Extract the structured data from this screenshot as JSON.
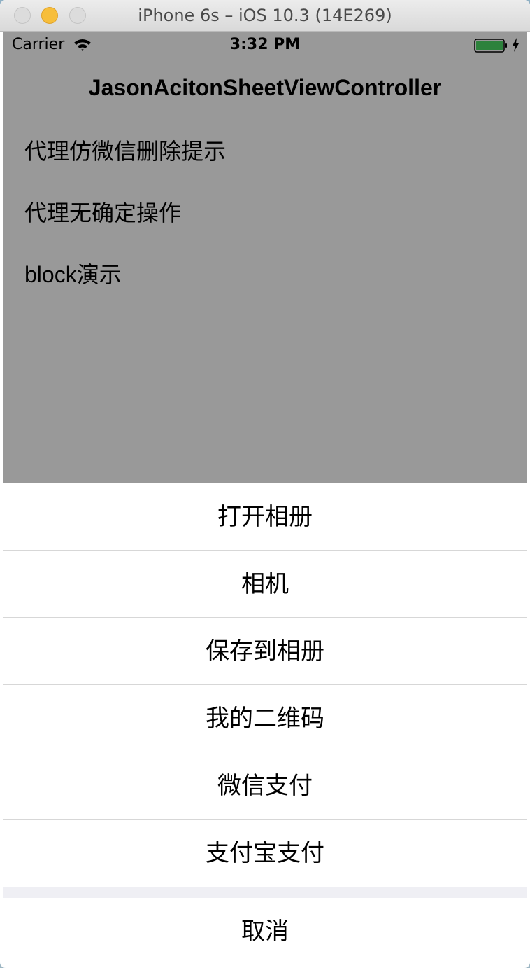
{
  "window": {
    "title": "iPhone 6s – iOS 10.3 (14E269)"
  },
  "status_bar": {
    "carrier": "Carrier",
    "time": "3:32 PM",
    "wifi_icon": "wifi-icon",
    "battery_icon": "battery-icon",
    "charging_icon": "charging-bolt-icon",
    "battery_color": "#4cd964"
  },
  "nav_bar": {
    "title": "JasonAcitonSheetViewController"
  },
  "list": {
    "items": [
      {
        "label": "代理仿微信删除提示"
      },
      {
        "label": "代理无确定操作"
      },
      {
        "label": "block演示"
      }
    ]
  },
  "action_sheet": {
    "options": [
      {
        "label": "打开相册"
      },
      {
        "label": "相机"
      },
      {
        "label": "保存到相册"
      },
      {
        "label": "我的二维码"
      },
      {
        "label": "微信支付"
      },
      {
        "label": "支付宝支付"
      }
    ],
    "cancel_label": "取消"
  }
}
